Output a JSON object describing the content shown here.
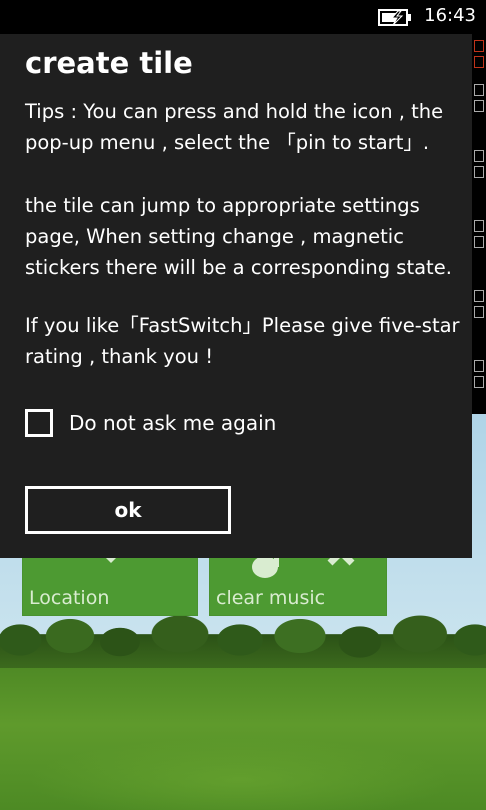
{
  "status_bar": {
    "time": "16:43",
    "battery_icon": "battery-charging-icon"
  },
  "dialog": {
    "title": "create tile",
    "paragraphs": [
      "Tips : You can press and hold the icon , the pop-up menu , select the 「pin to start」.",
      "the tile can jump to appropriate settings page, When setting change , magnetic stickers there will be a corresponding state.",
      "If you like「FastSwitch」Please give five-star rating , thank you !"
    ],
    "checkbox_label": "Do not ask me again",
    "checkbox_checked": false,
    "ok_label": "ok"
  },
  "tiles": [
    {
      "label": "Location",
      "icon": "location-icon",
      "color": "#4d9a32"
    },
    {
      "label": "clear music",
      "icon": "music-note-icon",
      "color": "#4d9a32"
    }
  ],
  "colors": {
    "dialog_bg": "#1f1f1f",
    "tile_green": "#4d9a32",
    "edge_accent": "#c0331a"
  }
}
